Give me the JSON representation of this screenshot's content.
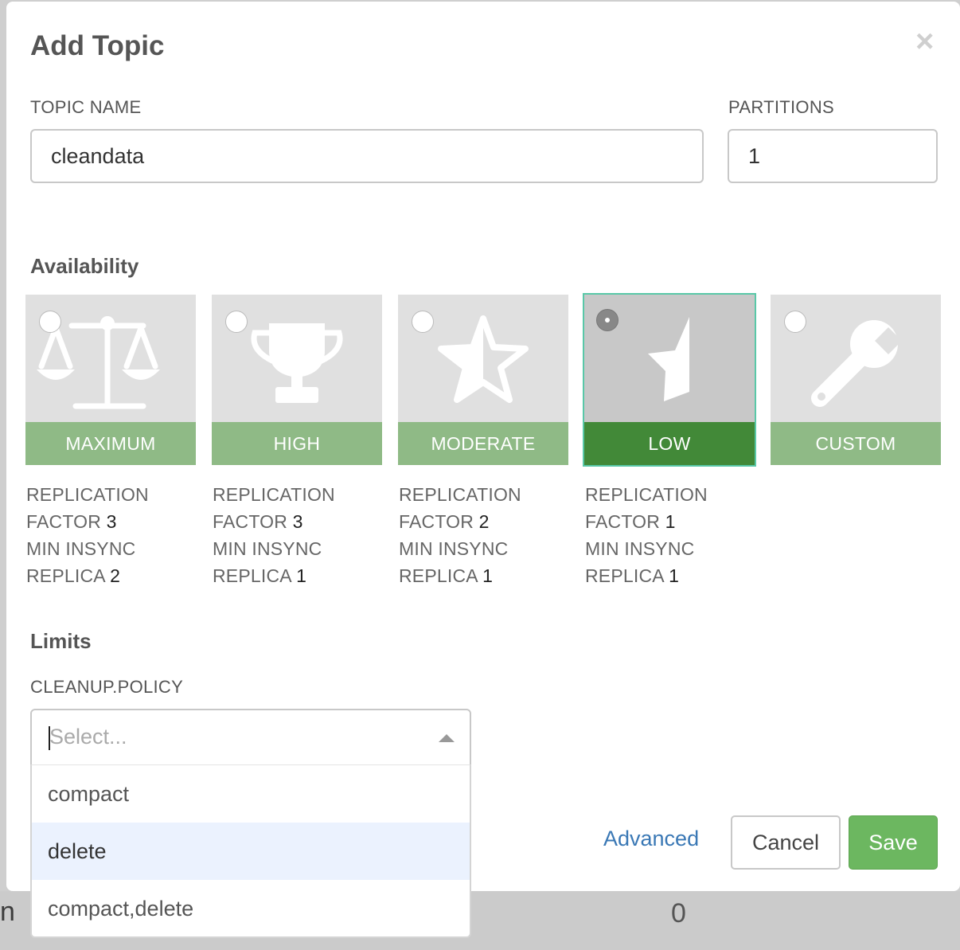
{
  "dialog": {
    "title": "Add Topic",
    "close_label": "×"
  },
  "topic_name": {
    "label": "TOPIC NAME",
    "value": "cleandata"
  },
  "partitions": {
    "label": "PARTITIONS",
    "value": "1"
  },
  "availability": {
    "title": "Availability",
    "selected": "LOW",
    "options": [
      {
        "label": "MAXIMUM",
        "icon": "balance-scale-icon",
        "spec": {
          "rf_label_1": "REPLICATION",
          "rf_label_2": "FACTOR",
          "rf_value": "3",
          "mi_label_1": "MIN INSYNC",
          "mi_label_2": "REPLICA",
          "mi_value": "2"
        }
      },
      {
        "label": "HIGH",
        "icon": "trophy-icon",
        "spec": {
          "rf_label_1": "REPLICATION",
          "rf_label_2": "FACTOR",
          "rf_value": "3",
          "mi_label_1": "MIN INSYNC",
          "mi_label_2": "REPLICA",
          "mi_value": "1"
        }
      },
      {
        "label": "MODERATE",
        "icon": "half-star-icon",
        "spec": {
          "rf_label_1": "REPLICATION",
          "rf_label_2": "FACTOR",
          "rf_value": "2",
          "mi_label_1": "MIN INSYNC",
          "mi_label_2": "REPLICA",
          "mi_value": "1"
        }
      },
      {
        "label": "LOW",
        "icon": "star-fragment-icon",
        "spec": {
          "rf_label_1": "REPLICATION",
          "rf_label_2": "FACTOR",
          "rf_value": "1",
          "mi_label_1": "MIN INSYNC",
          "mi_label_2": "REPLICA",
          "mi_value": "1"
        }
      },
      {
        "label": "CUSTOM",
        "icon": "wrench-icon"
      }
    ]
  },
  "limits": {
    "title": "Limits",
    "cleanup_policy": {
      "label": "CLEANUP.POLICY",
      "placeholder": "Select...",
      "options": [
        "compact",
        "delete",
        "compact,delete"
      ],
      "focused_option": "delete"
    }
  },
  "footer": {
    "advanced_label": "Advanced",
    "cancel_label": "Cancel",
    "save_label": "Save"
  },
  "background": {
    "cell_left": "n",
    "cell_value": "0"
  },
  "colors": {
    "band": "#8fba86",
    "band_selected": "#428938",
    "save_button": "#6cb760",
    "link": "#3a78b5",
    "selected_outline": "#59c8a8"
  }
}
